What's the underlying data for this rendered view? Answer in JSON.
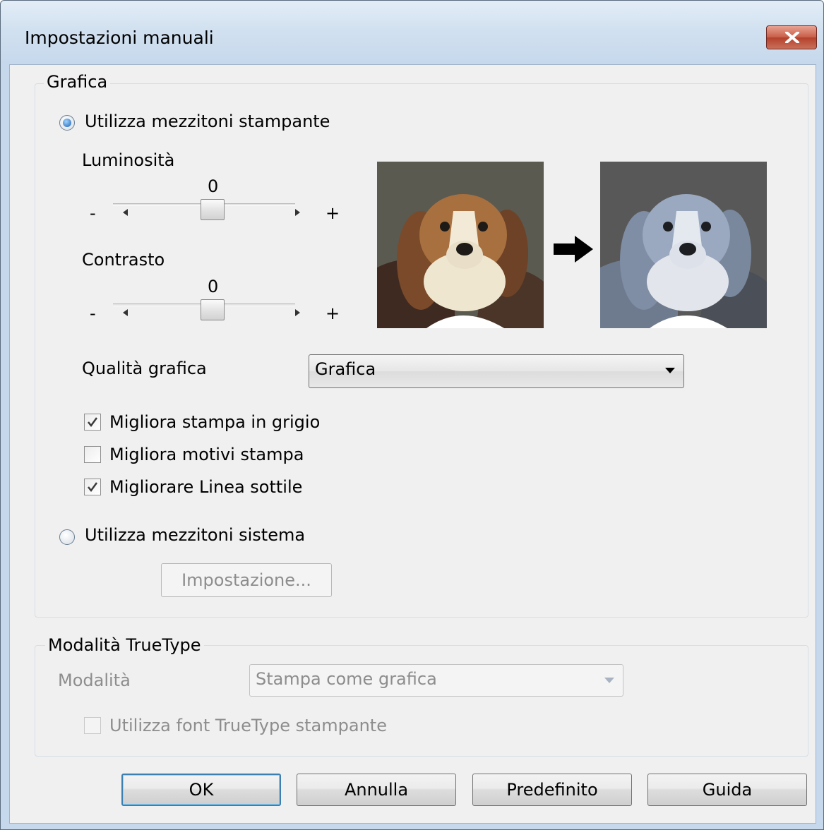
{
  "window": {
    "title": "Impostazioni manuali",
    "close_icon": "close-icon"
  },
  "grafica": {
    "group_label": "Grafica",
    "radio_printer": {
      "label": "Utilizza mezzitoni stampante",
      "selected": true
    },
    "brightness": {
      "label": "Luminosità",
      "value": "0",
      "min_label": "-",
      "max_label": "+"
    },
    "contrast": {
      "label": "Contrasto",
      "value": "0",
      "min_label": "-",
      "max_label": "+"
    },
    "preview_arrow": "arrow-right-icon",
    "quality": {
      "label": "Qualità grafica",
      "selected": "Grafica"
    },
    "checkboxes": [
      {
        "label": "Migliora stampa in grigio",
        "checked": true
      },
      {
        "label": "Migliora motivi stampa",
        "checked": false
      },
      {
        "label": "Migliorare Linea sottile",
        "checked": true
      }
    ],
    "radio_system": {
      "label": "Utilizza mezzitoni sistema",
      "selected": false
    },
    "settings_button": "Impostazione..."
  },
  "truetype": {
    "group_label": "Modalità TrueType",
    "mode_label": "Modalità",
    "mode_value": "Stampa come grafica",
    "use_printer_fonts": {
      "label": "Utilizza font TrueType stampante",
      "checked": false
    }
  },
  "buttons": {
    "ok": "OK",
    "cancel": "Annulla",
    "defaults": "Predefinito",
    "help": "Guida"
  },
  "colors": {
    "accent": "#1b5fb0",
    "close": "#c75e48",
    "titlebar": "#d2e1f0"
  }
}
